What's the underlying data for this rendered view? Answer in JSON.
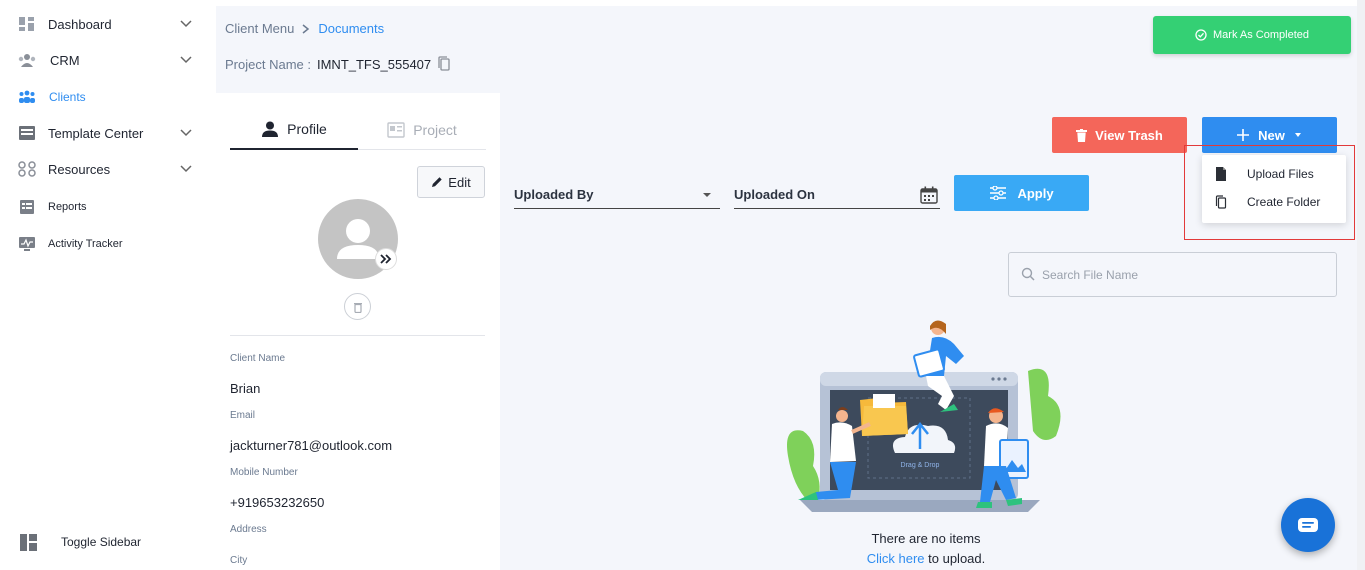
{
  "sidebar": {
    "items": [
      {
        "label": "Dashboard",
        "icon": "dashboard-icon",
        "has_chevron": true
      },
      {
        "label": "CRM",
        "icon": "crm-icon",
        "has_chevron": true
      },
      {
        "label": "Clients",
        "icon": "clients-icon",
        "active": true
      },
      {
        "label": "Template Center",
        "icon": "template-icon",
        "has_chevron": true
      },
      {
        "label": "Resources",
        "icon": "resources-icon",
        "has_chevron": true
      },
      {
        "label": "Reports",
        "icon": "reports-icon"
      },
      {
        "label": "Activity Tracker",
        "icon": "activity-icon"
      }
    ],
    "toggle_label": "Toggle Sidebar"
  },
  "breadcrumb": {
    "parent": "Client Menu",
    "current": "Documents"
  },
  "project": {
    "label": "Project Name :",
    "value": "IMNT_TFS_555407"
  },
  "mark_completed_label": "Mark As Completed",
  "profile_card": {
    "tabs": {
      "profile": "Profile",
      "project": "Project"
    },
    "edit_label": "Edit",
    "fields": {
      "client_name_label": "Client Name",
      "client_name": "Brian",
      "email_label": "Email",
      "email": "jackturner781@outlook.com",
      "mobile_label": "Mobile Number",
      "mobile": "+919653232650",
      "address_label": "Address",
      "city_label": "City"
    }
  },
  "toolbar": {
    "view_trash_label": "View Trash",
    "new_label": "New",
    "new_menu": {
      "upload_files": "Upload Files",
      "create_folder": "Create Folder"
    }
  },
  "filters": {
    "uploaded_by_label": "Uploaded By",
    "uploaded_on_label": "Uploaded On",
    "apply_label": "Apply"
  },
  "search": {
    "placeholder": "Search File Name"
  },
  "illustration": {
    "caption": "Drag & Drop"
  },
  "empty_state": {
    "message": "There are no items",
    "link_text": "Click here",
    "link_suffix": " to upload."
  },
  "colors": {
    "primary": "#2f8df0",
    "success": "#34d074",
    "danger": "#f4665a",
    "apply": "#39a9f5",
    "highlight": "#e23a3a"
  }
}
